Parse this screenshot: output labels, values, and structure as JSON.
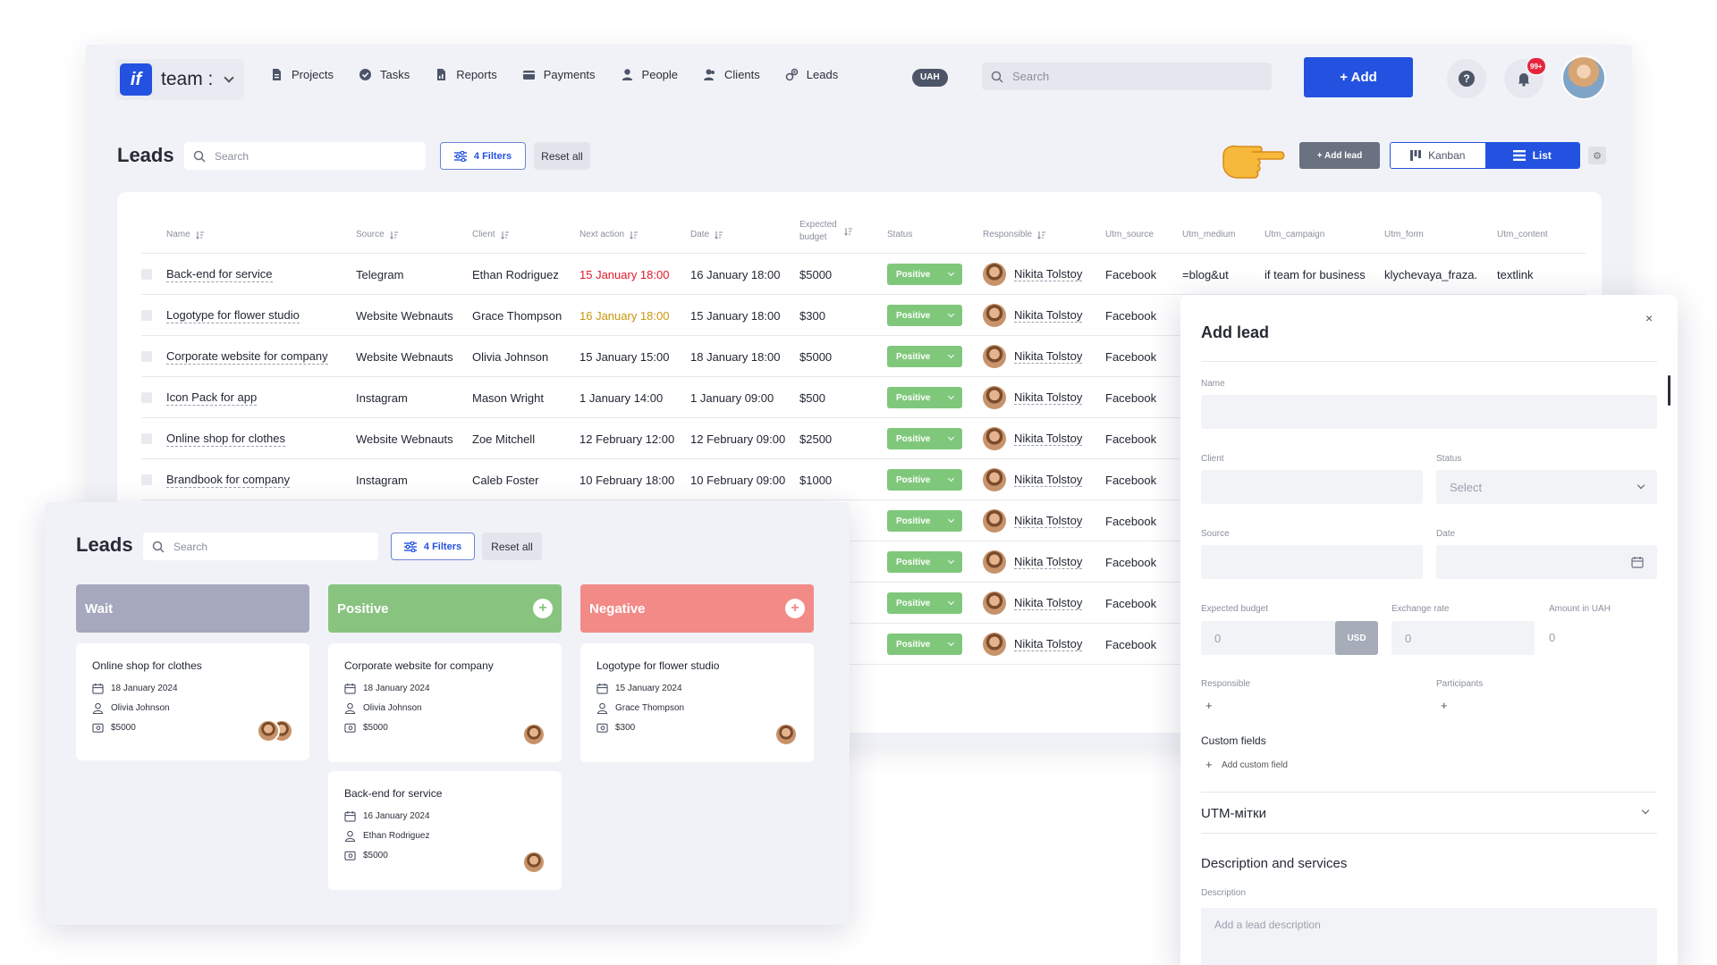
{
  "header": {
    "brand": "team :",
    "nav": [
      {
        "label": "Projects",
        "icon": "file-icon"
      },
      {
        "label": "Tasks",
        "icon": "check-circle-icon"
      },
      {
        "label": "Reports",
        "icon": "report-icon"
      },
      {
        "label": "Payments",
        "icon": "wallet-icon"
      },
      {
        "label": "People",
        "icon": "person-icon"
      },
      {
        "label": "Clients",
        "icon": "clients-icon"
      },
      {
        "label": "Leads",
        "icon": "leads-icon"
      }
    ],
    "currency": "UAH",
    "search_placeholder": "Search",
    "add_label": "+ Add",
    "help_label": "?",
    "notifications_badge": "99+",
    "accent_color": "#2352e0"
  },
  "leads_page": {
    "title": "Leads",
    "search_placeholder": "Search",
    "filters_label": "4 Filters",
    "reset_label": "Reset all",
    "add_lead_label": "+ Add lead",
    "view_kanban": "Kanban",
    "view_list": "List",
    "active_view": "List"
  },
  "table": {
    "columns": [
      "Name",
      "Source",
      "Client",
      "Next action",
      "Date",
      "Expected budget",
      "Status",
      "Responsible",
      "Utm_source",
      "Utm_medium",
      "Utm_campaign",
      "Utm_form",
      "Utm_content"
    ],
    "rows": [
      {
        "name": "Back-end for service",
        "source": "Telegram",
        "client": "Ethan Rodriguez",
        "next_action": "15 January 18:00",
        "next_action_state": "overdue",
        "date": "16 January 18:00",
        "budget": "$5000",
        "status": "Positive",
        "responsible": "Nikita Tolstoy",
        "utm_source": "Facebook",
        "utm_medium": "=blog&ut",
        "utm_campaign": "if team for business",
        "utm_form": "klychevaya_fraza.",
        "utm_content": "textlink"
      },
      {
        "name": "Logotype for flower studio",
        "source": "Website Webnauts",
        "client": "Grace Thompson",
        "next_action": "16 January 18:00",
        "next_action_state": "today",
        "date": "15 January 18:00",
        "budget": "$300",
        "status": "Positive",
        "responsible": "Nikita Tolstoy",
        "utm_source": "Facebook"
      },
      {
        "name": "Corporate website for company",
        "source": "Website Webnauts",
        "client": "Olivia Johnson",
        "next_action": "15 January 15:00",
        "next_action_state": "normal",
        "date": "18 January 18:00",
        "budget": "$5000",
        "status": "Positive",
        "responsible": "Nikita Tolstoy",
        "utm_source": "Facebook"
      },
      {
        "name": "Icon Pack for app",
        "source": "Instagram",
        "client": "Mason Wright",
        "next_action": "1 January 14:00",
        "next_action_state": "normal",
        "date": "1 January 09:00",
        "budget": "$500",
        "status": "Positive",
        "responsible": "Nikita Tolstoy",
        "utm_source": "Facebook"
      },
      {
        "name": "Online shop for clothes",
        "source": "Website Webnauts",
        "client": "Zoe Mitchell",
        "next_action": "12 February 12:00",
        "next_action_state": "normal",
        "date": "12 February 09:00",
        "budget": "$2500",
        "status": "Positive",
        "responsible": "Nikita Tolstoy",
        "utm_source": "Facebook"
      },
      {
        "name": "Brandbook for company",
        "source": "Instagram",
        "client": "Caleb Foster",
        "next_action": "10 February 18:00",
        "next_action_state": "normal",
        "date": "10 February 09:00",
        "budget": "$1000",
        "status": "Positive",
        "responsible": "Nikita Tolstoy",
        "utm_source": "Facebook"
      },
      {
        "name": "",
        "status": "Positive",
        "responsible": "Nikita Tolstoy",
        "utm_source": "Facebook"
      },
      {
        "name": "",
        "status": "Positive",
        "responsible": "Nikita Tolstoy",
        "utm_source": "Facebook"
      },
      {
        "name": "",
        "status": "Positive",
        "responsible": "Nikita Tolstoy",
        "utm_source": "Facebook"
      },
      {
        "name": "",
        "status": "Positive",
        "responsible": "Nikita Tolstoy",
        "utm_source": "Facebook"
      }
    ],
    "status_color": "#7fc87b"
  },
  "kanban": {
    "title": "Leads",
    "search_placeholder": "Search",
    "filters_label": "4 Filters",
    "reset_label": "Reset all",
    "columns": [
      {
        "title": "Wait",
        "color": "#a6a9bd",
        "has_add": false,
        "cards": [
          {
            "title": "Online shop for clothes",
            "date": "18 January 2024",
            "person": "Olivia Johnson",
            "amount": "$5000"
          }
        ]
      },
      {
        "title": "Positive",
        "color": "#88c47f",
        "has_add": true,
        "cards": [
          {
            "title": "Corporate website for company",
            "date": "18 January 2024",
            "person": "Olivia Johnson",
            "amount": "$5000"
          },
          {
            "title": "Back-end for service",
            "date": "16 January 2024",
            "person": "Ethan Rodriguez",
            "amount": "$5000"
          }
        ]
      },
      {
        "title": "Negative",
        "color": "#f28b88",
        "has_add": true,
        "cards": [
          {
            "title": "Logotype for flower studio",
            "date": "15 January 2024",
            "person": "Grace Thompson",
            "amount": "$300"
          }
        ]
      }
    ]
  },
  "add_lead": {
    "title": "Add lead",
    "close": "×",
    "name_label": "Name",
    "client_label": "Client",
    "status_label": "Status",
    "status_placeholder": "Select",
    "source_label": "Source",
    "date_label": "Date",
    "budget_label": "Expected budget",
    "budget_value": "0",
    "currency_btn": "USD",
    "exchange_label": "Exchange rate",
    "exchange_value": "0",
    "amount_uah_label": "Amount in UAH",
    "amount_uah_value": "0",
    "responsible_label": "Responsible",
    "participants_label": "Participants",
    "plus": "+",
    "custom_fields_label": "Custom fields",
    "add_custom_field": "Add custom field",
    "utm_label": "UTM-мітки",
    "description_section": "Description and services",
    "description_label": "Description",
    "description_placeholder": "Add a lead description"
  }
}
